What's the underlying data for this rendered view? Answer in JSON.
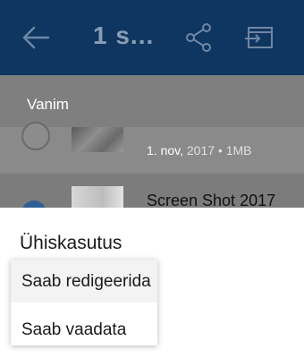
{
  "appbar": {
    "title": "1 s...",
    "icons": {
      "back": "back-arrow-icon",
      "share": "share-icon",
      "move": "move-to-folder-icon"
    }
  },
  "sort": {
    "label": "Vanim"
  },
  "files": [
    {
      "date": "1. nov,",
      "year_size": "2017 • 1MB",
      "selected": false
    },
    {
      "name": "Screen Shot 2017",
      "selected": true
    }
  ],
  "sheet": {
    "title": "Ühiskasutus",
    "options": [
      {
        "label": "Saab redigeerida",
        "selected": true
      },
      {
        "label": "Saab vaadata",
        "selected": false
      }
    ]
  },
  "colors": {
    "appbar": "#0f3660",
    "scrim": "#7f7f7f",
    "accent": "#2f5f95"
  }
}
